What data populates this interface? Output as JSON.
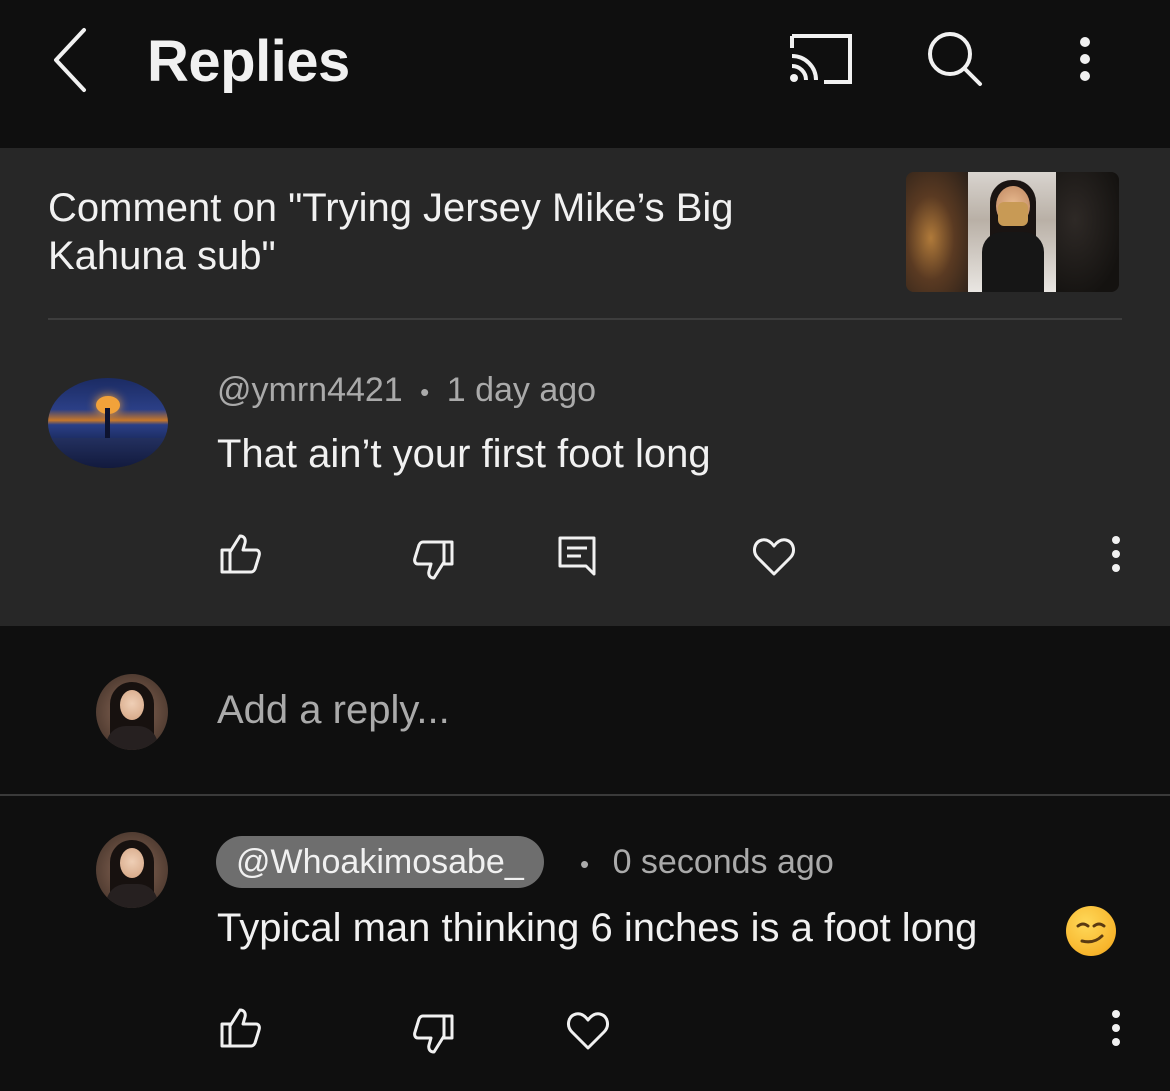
{
  "header": {
    "title": "Replies"
  },
  "parent": {
    "context": "Comment on \"Trying Jersey Mike’s Big Kahuna sub\"",
    "author": "@ymrn4421",
    "time": "1 day ago",
    "text": "That ain’t your first foot long"
  },
  "reply_box": {
    "placeholder": "Add a reply..."
  },
  "reply": {
    "author": "@Whoakimosabe_",
    "time": "0 seconds ago",
    "text": "Typical man thinking 6 inches is a foot long"
  },
  "separator": "•",
  "colors": {
    "background": "#0f0f0f",
    "panel": "#272727",
    "text": "#f1f1f1",
    "secondary_text": "#aaaaaa",
    "chip": "#6e6e6e"
  },
  "icons": {
    "back": "chevron-left-icon",
    "cast": "cast-icon",
    "search": "search-icon",
    "more": "more-vert-icon",
    "like": "thumb-up-icon",
    "dislike": "thumb-down-icon",
    "reply": "comment-icon",
    "heart": "heart-icon",
    "emoji": "smirk-emoji-icon"
  }
}
